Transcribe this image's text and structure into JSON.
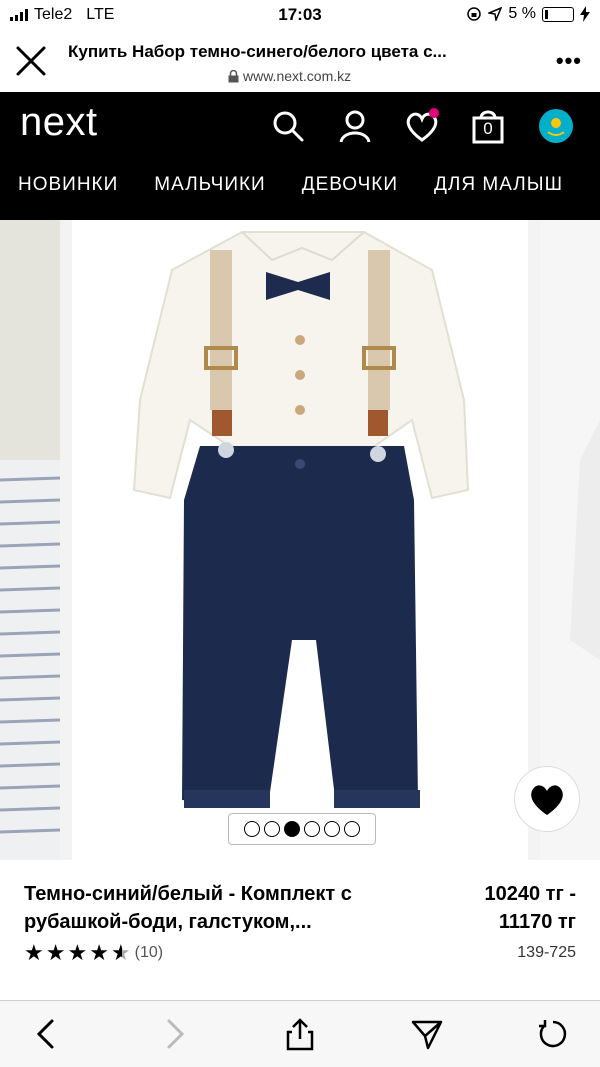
{
  "status": {
    "carrier": "Tele2",
    "network": "LTE",
    "time": "17:03",
    "battery": "5 %"
  },
  "browser": {
    "title": "Купить Набор темно-синего/белого цвета с...",
    "domain": "www.next.com.kz"
  },
  "header": {
    "logo": "next",
    "cart_count": "0",
    "nav": [
      "НОВИНКИ",
      "МАЛЬЧИКИ",
      "ДЕВОЧКИ",
      "ДЛЯ МАЛЫШ"
    ]
  },
  "gallery": {
    "image_count": 6,
    "active_index": 2
  },
  "product": {
    "name": "Темно-синий/белый - Комплект с рубашкой-боди, галстуком,...",
    "price_from": "10240 тг -",
    "price_to": "11170 тг",
    "rating": 4.5,
    "rating_count": "(10)",
    "code": "139-725"
  },
  "colors": {
    "header_bg": "#000000",
    "fav_dot": "#e6007e",
    "pants": "#1c2a4d",
    "shirt": "#f6f4ec",
    "suspenders": "#d9c8ad"
  }
}
